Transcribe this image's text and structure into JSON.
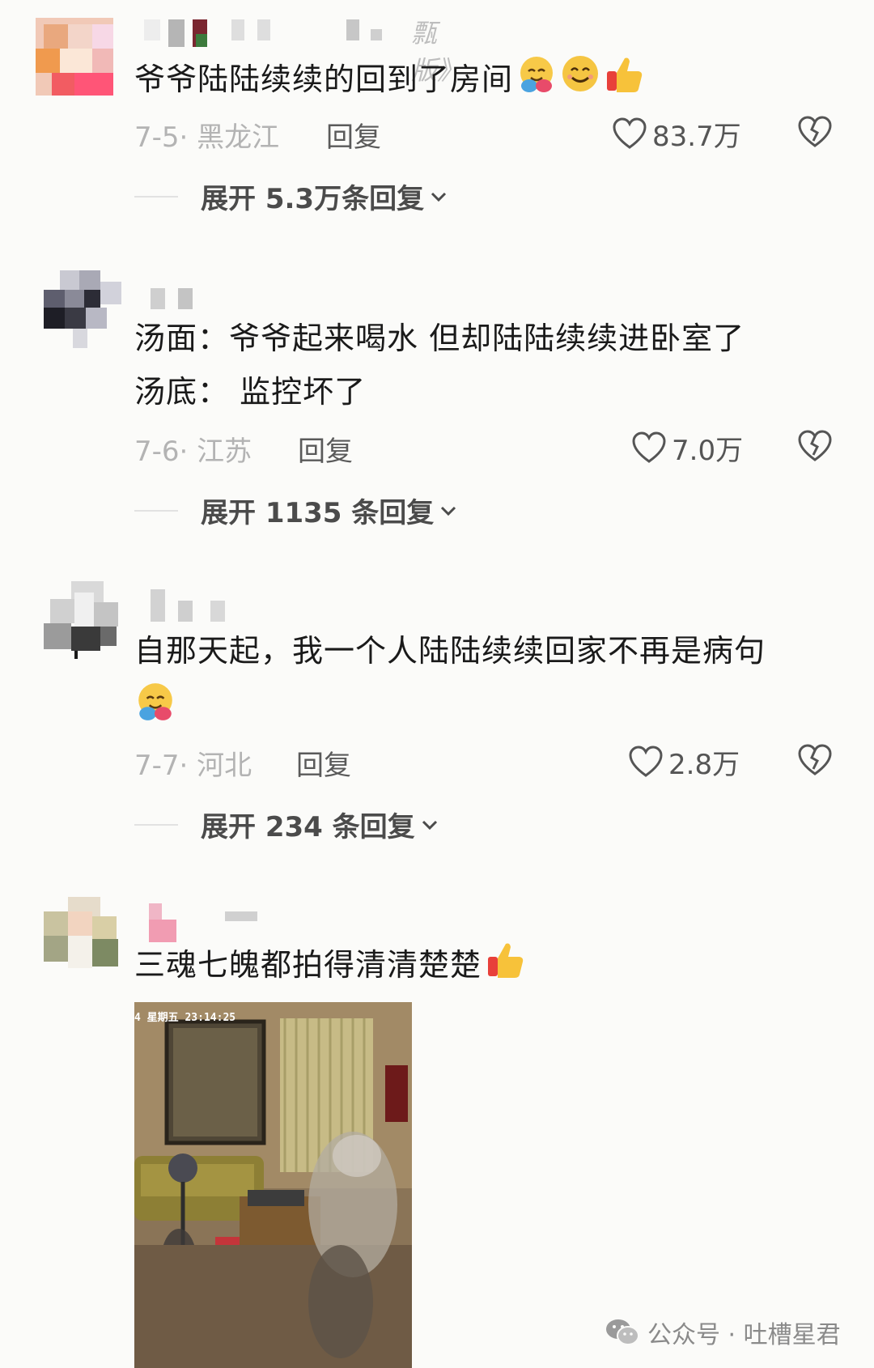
{
  "comments": [
    {
      "username_partial": "㼼版》",
      "text": "爷爷陆陆续续的回到了房间",
      "emojis": [
        "hugging-face",
        "smiling-face",
        "thumbs-up"
      ],
      "date_location": "7-5· 黑龙江",
      "reply_label": "回复",
      "likes": "83.7万",
      "expand_label": "展开 5.3万条回复"
    },
    {
      "text_line1": "汤面：爷爷起来喝水 但却陆陆续续进卧室了",
      "text_line2": "汤底： 监控坏了",
      "date_location": "7-6· 江苏",
      "reply_label": "回复",
      "likes": "7.0万",
      "expand_label": "展开 1135 条回复"
    },
    {
      "text": "自那天起，我一个人陆陆续续回家不再是病句",
      "emojis": [
        "hugging-face"
      ],
      "date_location": "7-7· 河北",
      "reply_label": "回复",
      "likes": "2.8万",
      "expand_label": "展开 234 条回复"
    },
    {
      "text": "三魂七魄都拍得清清楚楚",
      "emojis": [
        "thumbs-up"
      ],
      "photo_timestamp": "4 星期五 23:14:25"
    }
  ],
  "watermark": {
    "text": "公众号 · 吐槽星君",
    "icon": "wechat-icon"
  },
  "colors": {
    "background": "#fbfbf9",
    "text": "#1a1a1a",
    "meta": "#b3b3b3"
  }
}
